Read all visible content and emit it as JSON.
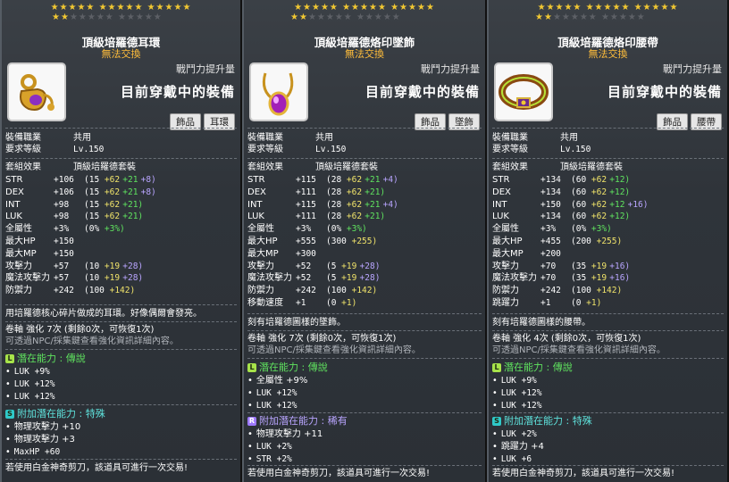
{
  "tooltips": [
    {
      "stars_row1": [
        "★★★★★",
        "★★★★★",
        "★★★★★"
      ],
      "stars_row2_on": "★★",
      "stars_row2_off": "★★★★★ ★★★★★",
      "title": "頂級培羅德耳環",
      "subtitle": "無法交換",
      "power_label": "戰鬥力提升量",
      "icon": "earring-icon",
      "equipped_label": "目前穿戴中的裝備",
      "tags": [
        "飾品",
        "耳環"
      ],
      "job_label": "裝備職業",
      "job_value": "共用",
      "level_label": "要求等級",
      "level_value": "Lv.150",
      "set_label": "套組效果",
      "set_value": "頂級培羅德套裝",
      "stats": [
        {
          "k": "STR",
          "v": "+106",
          "a": "(15 ",
          "b": "+62",
          "c": "+21",
          "d": "+8)"
        },
        {
          "k": "DEX",
          "v": "+106",
          "a": "(15 ",
          "b": "+62",
          "c": "+21",
          "d": "+8)"
        },
        {
          "k": "INT",
          "v": "+98",
          "a": "(15 ",
          "b": "+62",
          "c": "+21)",
          "d": ""
        },
        {
          "k": "LUK",
          "v": "+98",
          "a": "(15 ",
          "b": "+62",
          "c": "+21)",
          "d": ""
        },
        {
          "k": "全屬性",
          "v": "+3%",
          "a": "(0% ",
          "b": "",
          "c": "+3%)",
          "d": ""
        },
        {
          "k": "最大HP",
          "v": "+150",
          "a": "",
          "b": "",
          "c": "",
          "d": ""
        },
        {
          "k": "最大MP",
          "v": "+150",
          "a": "",
          "b": "",
          "c": "",
          "d": ""
        },
        {
          "k": "攻擊力",
          "v": "+57",
          "a": "(10 ",
          "b": "+19",
          "c": "",
          "d": "+28)"
        },
        {
          "k": "魔法攻擊力",
          "v": "+57",
          "a": "(10 ",
          "b": "+19",
          "c": "",
          "d": "+28)"
        },
        {
          "k": "防禦力",
          "v": "+242",
          "a": "(100 ",
          "b": "+142)",
          "c": "",
          "d": ""
        }
      ],
      "desc": "用培羅德核心碎片做成的耳環。好像偶爾會發亮。",
      "scroll": "卷軸 強化 7次 (剩餘0次，可恢復1次)",
      "hint": "可透過NPC/採集鍵查看強化資訊詳細內容。",
      "potential_label": "潛在能力 : ",
      "potential_grade": "傳說",
      "potential": [
        "LUK +9%",
        "LUK +12%",
        "LUK +12%"
      ],
      "additional_label": "附加潛在能力 : ",
      "additional_grade": "特殊",
      "additional": [
        "物理攻擊力 +10",
        "物理攻擊力 +3",
        "MaxHP +60"
      ],
      "footer": "若使用白金神奇剪刀，該道具可進行一次交易!"
    },
    {
      "stars_row1": [
        "★★★★★",
        "★★★★★",
        "★★★★★"
      ],
      "stars_row2_on": "★★",
      "stars_row2_off": "★★★★★ ★★★★★",
      "title": "頂級培羅德烙印墜飾",
      "subtitle": "無法交換",
      "power_label": "戰鬥力提升量",
      "icon": "pendant-icon",
      "equipped_label": "目前穿戴中的裝備",
      "tags": [
        "飾品",
        "墜飾"
      ],
      "job_label": "裝備職業",
      "job_value": "共用",
      "level_label": "要求等級",
      "level_value": "Lv.150",
      "set_label": "套組效果",
      "set_value": "頂級培羅德套裝",
      "stats": [
        {
          "k": "STR",
          "v": "+115",
          "a": "(28 ",
          "b": "+62",
          "c": "+21",
          "d": "+4)"
        },
        {
          "k": "DEX",
          "v": "+111",
          "a": "(28 ",
          "b": "+62",
          "c": "+21)",
          "d": ""
        },
        {
          "k": "INT",
          "v": "+115",
          "a": "(28 ",
          "b": "+62",
          "c": "+21",
          "d": "+4)"
        },
        {
          "k": "LUK",
          "v": "+111",
          "a": "(28 ",
          "b": "+62",
          "c": "+21)",
          "d": ""
        },
        {
          "k": "全屬性",
          "v": "+3%",
          "a": "(0% ",
          "b": "",
          "c": "+3%)",
          "d": ""
        },
        {
          "k": "最大HP",
          "v": "+555",
          "a": "(300 ",
          "b": "+255)",
          "c": "",
          "d": ""
        },
        {
          "k": "最大MP",
          "v": "+300",
          "a": "",
          "b": "",
          "c": "",
          "d": ""
        },
        {
          "k": "攻擊力",
          "v": "+52",
          "a": "(5 ",
          "b": "+19",
          "c": "",
          "d": "+28)"
        },
        {
          "k": "魔法攻擊力",
          "v": "+52",
          "a": "(5 ",
          "b": "+19",
          "c": "",
          "d": "+28)"
        },
        {
          "k": "防禦力",
          "v": "+242",
          "a": "(100 ",
          "b": "+142)",
          "c": "",
          "d": ""
        },
        {
          "k": "移動速度",
          "v": "+1",
          "a": "(0 ",
          "b": "+1)",
          "c": "",
          "d": ""
        }
      ],
      "desc": "刻有培羅德圖樣的墜飾。",
      "scroll": "卷軸 強化 7次 (剩餘0次，可恢復1次)",
      "hint": "可透過NPC/採集鍵查看強化資訊詳細內容。",
      "potential_label": "潛在能力 : ",
      "potential_grade": "傳說",
      "potential": [
        "全屬性 +9%",
        "LUK +12%",
        "LUK +12%"
      ],
      "additional_label": "附加潛在能力 : ",
      "additional_grade": "稀有",
      "additional": [
        "物理攻擊力 +11",
        "LUK +2%",
        "STR +2%"
      ],
      "footer": "若使用白金神奇剪刀，該道具可進行一次交易!"
    },
    {
      "stars_row1": [
        "★★★★★",
        "★★★★★",
        "★★★★★"
      ],
      "stars_row2_on": "★★",
      "stars_row2_off": "★★★★★ ★★★★★",
      "title": "頂級培羅德烙印腰帶",
      "subtitle": "無法交換",
      "power_label": "戰鬥力提升量",
      "icon": "belt-icon",
      "equipped_label": "目前穿戴中的裝備",
      "tags": [
        "飾品",
        "腰帶"
      ],
      "job_label": "裝備職業",
      "job_value": "共用",
      "level_label": "要求等級",
      "level_value": "Lv.150",
      "set_label": "套組效果",
      "set_value": "頂級培羅德套裝",
      "stats": [
        {
          "k": "STR",
          "v": "+134",
          "a": "(60 ",
          "b": "+62",
          "c": "+12)",
          "d": ""
        },
        {
          "k": "DEX",
          "v": "+134",
          "a": "(60 ",
          "b": "+62",
          "c": "+12)",
          "d": ""
        },
        {
          "k": "INT",
          "v": "+150",
          "a": "(60 ",
          "b": "+62",
          "c": "+12",
          "d": "+16)"
        },
        {
          "k": "LUK",
          "v": "+134",
          "a": "(60 ",
          "b": "+62",
          "c": "+12)",
          "d": ""
        },
        {
          "k": "全屬性",
          "v": "+3%",
          "a": "(0% ",
          "b": "",
          "c": "+3%)",
          "d": ""
        },
        {
          "k": "最大HP",
          "v": "+455",
          "a": "(200 ",
          "b": "+255)",
          "c": "",
          "d": ""
        },
        {
          "k": "最大MP",
          "v": "+200",
          "a": "",
          "b": "",
          "c": "",
          "d": ""
        },
        {
          "k": "攻擊力",
          "v": "+70",
          "a": "(35 ",
          "b": "+19",
          "c": "",
          "d": "+16)"
        },
        {
          "k": "魔法攻擊力",
          "v": "+70",
          "a": "(35 ",
          "b": "+19",
          "c": "",
          "d": "+16)"
        },
        {
          "k": "防禦力",
          "v": "+242",
          "a": "(100 ",
          "b": "+142)",
          "c": "",
          "d": ""
        },
        {
          "k": "跳躍力",
          "v": "+1",
          "a": "(0 ",
          "b": "+1)",
          "c": "",
          "d": ""
        }
      ],
      "desc": "刻有培羅德圖樣的腰帶。",
      "scroll": "卷軸 強化 4次 (剩餘0次，可恢復1次)",
      "hint": "可透過NPC/採集鍵查看強化資訊詳細內容。",
      "potential_label": "潛在能力 : ",
      "potential_grade": "傳說",
      "potential": [
        "LUK +9%",
        "LUK +12%",
        "LUK +12%"
      ],
      "additional_label": "附加潛在能力 : ",
      "additional_grade": "特殊",
      "additional": [
        "LUK +2%",
        "跳躍力 +4",
        "LUK +6"
      ],
      "footer": "若使用白金神奇剪刀，該道具可進行一次交易!"
    }
  ]
}
